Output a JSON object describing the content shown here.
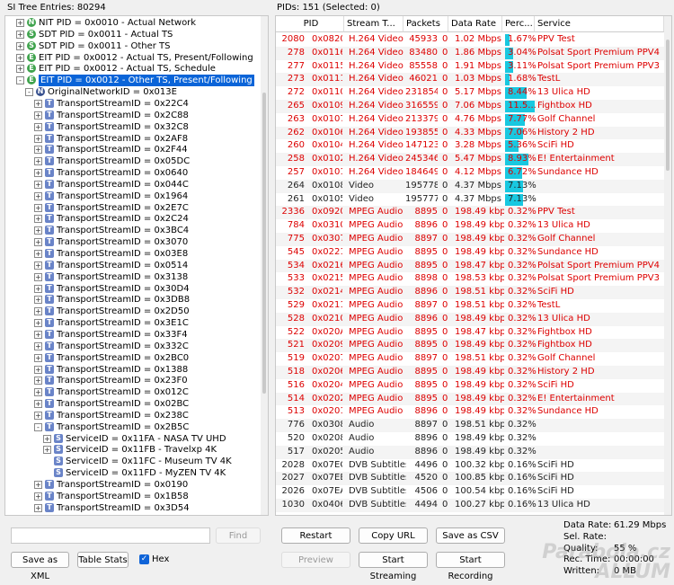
{
  "left_header": "SI Tree Entries: 80294",
  "right_header": "PIDs: 151   (Selected: 0)",
  "tree": [
    {
      "lvl": 0,
      "exp": "+",
      "icon": "N",
      "color": "green",
      "label": "NIT PID = 0x0010 - Actual Network"
    },
    {
      "lvl": 0,
      "exp": "+",
      "icon": "S",
      "color": "green",
      "label": "SDT PID = 0x0011 - Actual TS"
    },
    {
      "lvl": 0,
      "exp": "+",
      "icon": "S",
      "color": "green",
      "label": "SDT PID = 0x0011 - Other TS"
    },
    {
      "lvl": 0,
      "exp": "+",
      "icon": "E",
      "color": "green",
      "label": "EIT PID = 0x0012 - Actual TS, Present/Following"
    },
    {
      "lvl": 0,
      "exp": "+",
      "icon": "E",
      "color": "green",
      "label": "EIT PID = 0x0012 - Actual TS, Schedule"
    },
    {
      "lvl": 0,
      "exp": "-",
      "icon": "E",
      "color": "green",
      "label": "EIT PID = 0x0012 - Other TS, Present/Following",
      "sel": true
    },
    {
      "lvl": 1,
      "exp": "-",
      "icon": "N",
      "color": "navy",
      "label": "OriginalNetworkID = 0x013E"
    },
    {
      "lvl": 2,
      "exp": "+",
      "icon": "T",
      "color": "blue",
      "label": "TransportStreamID = 0x22C4"
    },
    {
      "lvl": 2,
      "exp": "+",
      "icon": "T",
      "color": "blue",
      "label": "TransportStreamID = 0x2C88"
    },
    {
      "lvl": 2,
      "exp": "+",
      "icon": "T",
      "color": "blue",
      "label": "TransportStreamID = 0x32C8"
    },
    {
      "lvl": 2,
      "exp": "+",
      "icon": "T",
      "color": "blue",
      "label": "TransportStreamID = 0x2AF8"
    },
    {
      "lvl": 2,
      "exp": "+",
      "icon": "T",
      "color": "blue",
      "label": "TransportStreamID = 0x2F44"
    },
    {
      "lvl": 2,
      "exp": "+",
      "icon": "T",
      "color": "blue",
      "label": "TransportStreamID = 0x05DC"
    },
    {
      "lvl": 2,
      "exp": "+",
      "icon": "T",
      "color": "blue",
      "label": "TransportStreamID = 0x0640"
    },
    {
      "lvl": 2,
      "exp": "+",
      "icon": "T",
      "color": "blue",
      "label": "TransportStreamID = 0x044C"
    },
    {
      "lvl": 2,
      "exp": "+",
      "icon": "T",
      "color": "blue",
      "label": "TransportStreamID = 0x1964"
    },
    {
      "lvl": 2,
      "exp": "+",
      "icon": "T",
      "color": "blue",
      "label": "TransportStreamID = 0x2E7C"
    },
    {
      "lvl": 2,
      "exp": "+",
      "icon": "T",
      "color": "blue",
      "label": "TransportStreamID = 0x2C24"
    },
    {
      "lvl": 2,
      "exp": "+",
      "icon": "T",
      "color": "blue",
      "label": "TransportStreamID = 0x3BC4"
    },
    {
      "lvl": 2,
      "exp": "+",
      "icon": "T",
      "color": "blue",
      "label": "TransportStreamID = 0x3070"
    },
    {
      "lvl": 2,
      "exp": "+",
      "icon": "T",
      "color": "blue",
      "label": "TransportStreamID = 0x03E8"
    },
    {
      "lvl": 2,
      "exp": "+",
      "icon": "T",
      "color": "blue",
      "label": "TransportStreamID = 0x0514"
    },
    {
      "lvl": 2,
      "exp": "+",
      "icon": "T",
      "color": "blue",
      "label": "TransportStreamID = 0x3138"
    },
    {
      "lvl": 2,
      "exp": "+",
      "icon": "T",
      "color": "blue",
      "label": "TransportStreamID = 0x30D4"
    },
    {
      "lvl": 2,
      "exp": "+",
      "icon": "T",
      "color": "blue",
      "label": "TransportStreamID = 0x3DB8"
    },
    {
      "lvl": 2,
      "exp": "+",
      "icon": "T",
      "color": "blue",
      "label": "TransportStreamID = 0x2D50"
    },
    {
      "lvl": 2,
      "exp": "+",
      "icon": "T",
      "color": "blue",
      "label": "TransportStreamID = 0x3E1C"
    },
    {
      "lvl": 2,
      "exp": "+",
      "icon": "T",
      "color": "blue",
      "label": "TransportStreamID = 0x33F4"
    },
    {
      "lvl": 2,
      "exp": "+",
      "icon": "T",
      "color": "blue",
      "label": "TransportStreamID = 0x332C"
    },
    {
      "lvl": 2,
      "exp": "+",
      "icon": "T",
      "color": "blue",
      "label": "TransportStreamID = 0x2BC0"
    },
    {
      "lvl": 2,
      "exp": "+",
      "icon": "T",
      "color": "blue",
      "label": "TransportStreamID = 0x1388"
    },
    {
      "lvl": 2,
      "exp": "+",
      "icon": "T",
      "color": "blue",
      "label": "TransportStreamID = 0x23F0"
    },
    {
      "lvl": 2,
      "exp": "+",
      "icon": "T",
      "color": "blue",
      "label": "TransportStreamID = 0x012C"
    },
    {
      "lvl": 2,
      "exp": "+",
      "icon": "T",
      "color": "blue",
      "label": "TransportStreamID = 0x02BC"
    },
    {
      "lvl": 2,
      "exp": "+",
      "icon": "T",
      "color": "blue",
      "label": "TransportStreamID = 0x238C"
    },
    {
      "lvl": 2,
      "exp": "-",
      "icon": "T",
      "color": "blue",
      "label": "TransportStreamID = 0x2B5C"
    },
    {
      "lvl": 3,
      "exp": "+",
      "icon": "S",
      "color": "blue",
      "label": "ServiceID = 0x11FA - NASA TV UHD"
    },
    {
      "lvl": 3,
      "exp": "+",
      "icon": "S",
      "color": "blue",
      "label": "ServiceID = 0x11FB - Travelxp 4K"
    },
    {
      "lvl": 3,
      "exp": "",
      "icon": "S",
      "color": "blue",
      "label": "ServiceID = 0x11FC - Museum TV 4K"
    },
    {
      "lvl": 3,
      "exp": "",
      "icon": "S",
      "color": "blue",
      "label": "ServiceID = 0x11FD - MyZEN TV 4K"
    },
    {
      "lvl": 2,
      "exp": "+",
      "icon": "T",
      "color": "blue",
      "label": "TransportStreamID = 0x0190"
    },
    {
      "lvl": 2,
      "exp": "+",
      "icon": "T",
      "color": "blue",
      "label": "TransportStreamID = 0x1B58"
    },
    {
      "lvl": 2,
      "exp": "+",
      "icon": "T",
      "color": "blue",
      "label": "TransportStreamID = 0x3D54"
    }
  ],
  "columns": [
    "PID",
    "Stream T...",
    "Packets",
    "Data Rate",
    "Perc...",
    "Service"
  ],
  "rows": [
    {
      "c": "red",
      "pid": "2080",
      "hex": "0x0820",
      "type": "H.264 Video",
      "pk": "45933",
      "e": "0",
      "rate": "1.02 Mbps",
      "pct": "1.67%",
      "p": 1.67,
      "svc": "PPV Test"
    },
    {
      "c": "red",
      "pid": "278",
      "hex": "0x0116",
      "type": "H.264 Video",
      "pk": "83480",
      "e": "0",
      "rate": "1.86 Mbps",
      "pct": "3.04%",
      "p": 3.04,
      "svc": "Polsat Sport Premium PPV4"
    },
    {
      "c": "red",
      "pid": "277",
      "hex": "0x0115",
      "type": "H.264 Video",
      "pk": "85558",
      "e": "0",
      "rate": "1.91 Mbps",
      "pct": "3.11%",
      "p": 3.11,
      "svc": "Polsat Sport Premium PPV3"
    },
    {
      "c": "red",
      "pid": "273",
      "hex": "0x0111",
      "type": "H.264 Video",
      "pk": "46021",
      "e": "0",
      "rate": "1.03 Mbps",
      "pct": "1.68%",
      "p": 1.68,
      "svc": "TestL"
    },
    {
      "c": "red",
      "pid": "272",
      "hex": "0x0110",
      "type": "H.264 Video",
      "pk": "231854",
      "e": "0",
      "rate": "5.17 Mbps",
      "pct": "8.44%",
      "p": 8.44,
      "svc": "13 Ulica HD"
    },
    {
      "c": "red",
      "pid": "265",
      "hex": "0x0109",
      "type": "H.264 Video",
      "pk": "316559",
      "e": "0",
      "rate": "7.06 Mbps",
      "pct": "11.5...",
      "p": 11.5,
      "svc": "Fightbox HD"
    },
    {
      "c": "red",
      "pid": "263",
      "hex": "0x0107",
      "type": "H.264 Video",
      "pk": "213379",
      "e": "0",
      "rate": "4.76 Mbps",
      "pct": "7.77%",
      "p": 7.77,
      "svc": "Golf Channel"
    },
    {
      "c": "red",
      "pid": "262",
      "hex": "0x0106",
      "type": "H.264 Video",
      "pk": "193855",
      "e": "0",
      "rate": "4.33 Mbps",
      "pct": "7.06%",
      "p": 7.06,
      "svc": "History 2 HD"
    },
    {
      "c": "red",
      "pid": "260",
      "hex": "0x0104",
      "type": "H.264 Video",
      "pk": "147123",
      "e": "0",
      "rate": "3.28 Mbps",
      "pct": "5.36%",
      "p": 5.36,
      "svc": "SciFi HD"
    },
    {
      "c": "red",
      "pid": "258",
      "hex": "0x0102",
      "type": "H.264 Video",
      "pk": "245346",
      "e": "0",
      "rate": "5.47 Mbps",
      "pct": "8.93%",
      "p": 8.93,
      "svc": "E! Entertainment"
    },
    {
      "c": "red",
      "pid": "257",
      "hex": "0x0101",
      "type": "H.264 Video",
      "pk": "184649",
      "e": "0",
      "rate": "4.12 Mbps",
      "pct": "6.72%",
      "p": 6.72,
      "svc": "Sundance HD"
    },
    {
      "c": "blk",
      "pid": "264",
      "hex": "0x0108",
      "type": "Video",
      "pk": "195778",
      "e": "0",
      "rate": "4.37 Mbps",
      "pct": "7.13%",
      "p": 7.13,
      "svc": ""
    },
    {
      "c": "blk",
      "pid": "261",
      "hex": "0x0105",
      "type": "Video",
      "pk": "195777",
      "e": "0",
      "rate": "4.37 Mbps",
      "pct": "7.13%",
      "p": 7.13,
      "svc": ""
    },
    {
      "c": "red",
      "pid": "2336",
      "hex": "0x0920",
      "type": "MPEG Audio",
      "pk": "8895",
      "e": "0",
      "rate": "198.49 kbps",
      "pct": "0.32%",
      "p": 0,
      "svc": "PPV Test"
    },
    {
      "c": "red",
      "pid": "784",
      "hex": "0x0310",
      "type": "MPEG Audio",
      "pk": "8896",
      "e": "0",
      "rate": "198.49 kbps",
      "pct": "0.32%",
      "p": 0,
      "svc": "13 Ulica HD"
    },
    {
      "c": "red",
      "pid": "775",
      "hex": "0x0307",
      "type": "MPEG Audio",
      "pk": "8897",
      "e": "0",
      "rate": "198.49 kbps",
      "pct": "0.32%",
      "p": 0,
      "svc": "Golf Channel"
    },
    {
      "c": "red",
      "pid": "545",
      "hex": "0x0221",
      "type": "MPEG Audio",
      "pk": "8895",
      "e": "0",
      "rate": "198.49 kbps",
      "pct": "0.32%",
      "p": 0,
      "svc": "Sundance HD"
    },
    {
      "c": "red",
      "pid": "534",
      "hex": "0x0216",
      "type": "MPEG Audio",
      "pk": "8895",
      "e": "0",
      "rate": "198.47 kbps",
      "pct": "0.32%",
      "p": 0,
      "svc": "Polsat Sport Premium PPV4"
    },
    {
      "c": "red",
      "pid": "533",
      "hex": "0x0215",
      "type": "MPEG Audio",
      "pk": "8898",
      "e": "0",
      "rate": "198.53 kbps",
      "pct": "0.32%",
      "p": 0,
      "svc": "Polsat Sport Premium PPV3"
    },
    {
      "c": "red",
      "pid": "532",
      "hex": "0x0214",
      "type": "MPEG Audio",
      "pk": "8896",
      "e": "0",
      "rate": "198.51 kbps",
      "pct": "0.32%",
      "p": 0,
      "svc": "SciFi HD"
    },
    {
      "c": "red",
      "pid": "529",
      "hex": "0x0211",
      "type": "MPEG Audio",
      "pk": "8897",
      "e": "0",
      "rate": "198.51 kbps",
      "pct": "0.32%",
      "p": 0,
      "svc": "TestL"
    },
    {
      "c": "red",
      "pid": "528",
      "hex": "0x0210",
      "type": "MPEG Audio",
      "pk": "8896",
      "e": "0",
      "rate": "198.49 kbps",
      "pct": "0.32%",
      "p": 0,
      "svc": "13 Ulica HD"
    },
    {
      "c": "red",
      "pid": "522",
      "hex": "0x020A",
      "type": "MPEG Audio",
      "pk": "8895",
      "e": "0",
      "rate": "198.47 kbps",
      "pct": "0.32%",
      "p": 0,
      "svc": "Fightbox HD"
    },
    {
      "c": "red",
      "pid": "521",
      "hex": "0x0209",
      "type": "MPEG Audio",
      "pk": "8895",
      "e": "0",
      "rate": "198.49 kbps",
      "pct": "0.32%",
      "p": 0,
      "svc": "Fightbox HD"
    },
    {
      "c": "red",
      "pid": "519",
      "hex": "0x0207",
      "type": "MPEG Audio",
      "pk": "8897",
      "e": "0",
      "rate": "198.51 kbps",
      "pct": "0.32%",
      "p": 0,
      "svc": "Golf Channel"
    },
    {
      "c": "red",
      "pid": "518",
      "hex": "0x0206",
      "type": "MPEG Audio",
      "pk": "8895",
      "e": "0",
      "rate": "198.49 kbps",
      "pct": "0.32%",
      "p": 0,
      "svc": "History 2 HD"
    },
    {
      "c": "red",
      "pid": "516",
      "hex": "0x0204",
      "type": "MPEG Audio",
      "pk": "8895",
      "e": "0",
      "rate": "198.49 kbps",
      "pct": "0.32%",
      "p": 0,
      "svc": "SciFi HD"
    },
    {
      "c": "red",
      "pid": "514",
      "hex": "0x0202",
      "type": "MPEG Audio",
      "pk": "8895",
      "e": "0",
      "rate": "198.49 kbps",
      "pct": "0.32%",
      "p": 0,
      "svc": "E! Entertainment"
    },
    {
      "c": "red",
      "pid": "513",
      "hex": "0x0201",
      "type": "MPEG Audio",
      "pk": "8896",
      "e": "0",
      "rate": "198.49 kbps",
      "pct": "0.32%",
      "p": 0,
      "svc": "Sundance HD"
    },
    {
      "c": "blk",
      "pid": "776",
      "hex": "0x0308",
      "type": "Audio",
      "pk": "8897",
      "e": "0",
      "rate": "198.51 kbps",
      "pct": "0.32%",
      "p": 0,
      "svc": ""
    },
    {
      "c": "blk",
      "pid": "520",
      "hex": "0x0208",
      "type": "Audio",
      "pk": "8896",
      "e": "0",
      "rate": "198.49 kbps",
      "pct": "0.32%",
      "p": 0,
      "svc": ""
    },
    {
      "c": "blk",
      "pid": "517",
      "hex": "0x0205",
      "type": "Audio",
      "pk": "8896",
      "e": "0",
      "rate": "198.49 kbps",
      "pct": "0.32%",
      "p": 0,
      "svc": ""
    },
    {
      "c": "blk",
      "pid": "2028",
      "hex": "0x07EC",
      "type": "DVB Subtitles",
      "pk": "4496",
      "e": "0",
      "rate": "100.32 kbps",
      "pct": "0.16%",
      "p": 0,
      "svc": "SciFi HD"
    },
    {
      "c": "blk",
      "pid": "2027",
      "hex": "0x07EB",
      "type": "DVB Subtitles",
      "pk": "4520",
      "e": "0",
      "rate": "100.85 kbps",
      "pct": "0.16%",
      "p": 0,
      "svc": "SciFi HD"
    },
    {
      "c": "blk",
      "pid": "2026",
      "hex": "0x07EA",
      "type": "DVB Subtitles",
      "pk": "4506",
      "e": "0",
      "rate": "100.54 kbps",
      "pct": "0.16%",
      "p": 0,
      "svc": "SciFi HD"
    },
    {
      "c": "blk",
      "pid": "1030",
      "hex": "0x0406",
      "type": "DVB Subtitles",
      "pk": "4494",
      "e": "0",
      "rate": "100.27 kbps",
      "pct": "0.16%",
      "p": 0,
      "svc": "13 Ulica HD"
    }
  ],
  "buttons": {
    "find": "Find",
    "save_xml": "Save as XML",
    "table_stats": "Table Stats",
    "hex": "Hex",
    "restart": "Restart",
    "copy_url": "Copy URL",
    "save_csv": "Save as CSV",
    "preview": "Preview",
    "start_streaming": "Start Streaming",
    "start_recording": "Start Recording"
  },
  "stats": [
    {
      "label": "Data Rate:",
      "value": "61.29 Mbps"
    },
    {
      "label": "Sel. Rate:",
      "value": ""
    },
    {
      "label": "Quality:",
      "value": "55 %"
    },
    {
      "label": "Rec. Time:",
      "value": "00:00:00"
    },
    {
      "label": "Written:",
      "value": "0 MB"
    }
  ],
  "watermark": "Parabola.cz\nALLUM",
  "colors": {
    "selection": "#0a64d8",
    "red_text": "#d00000",
    "percent_bar": "#18c8e0"
  }
}
